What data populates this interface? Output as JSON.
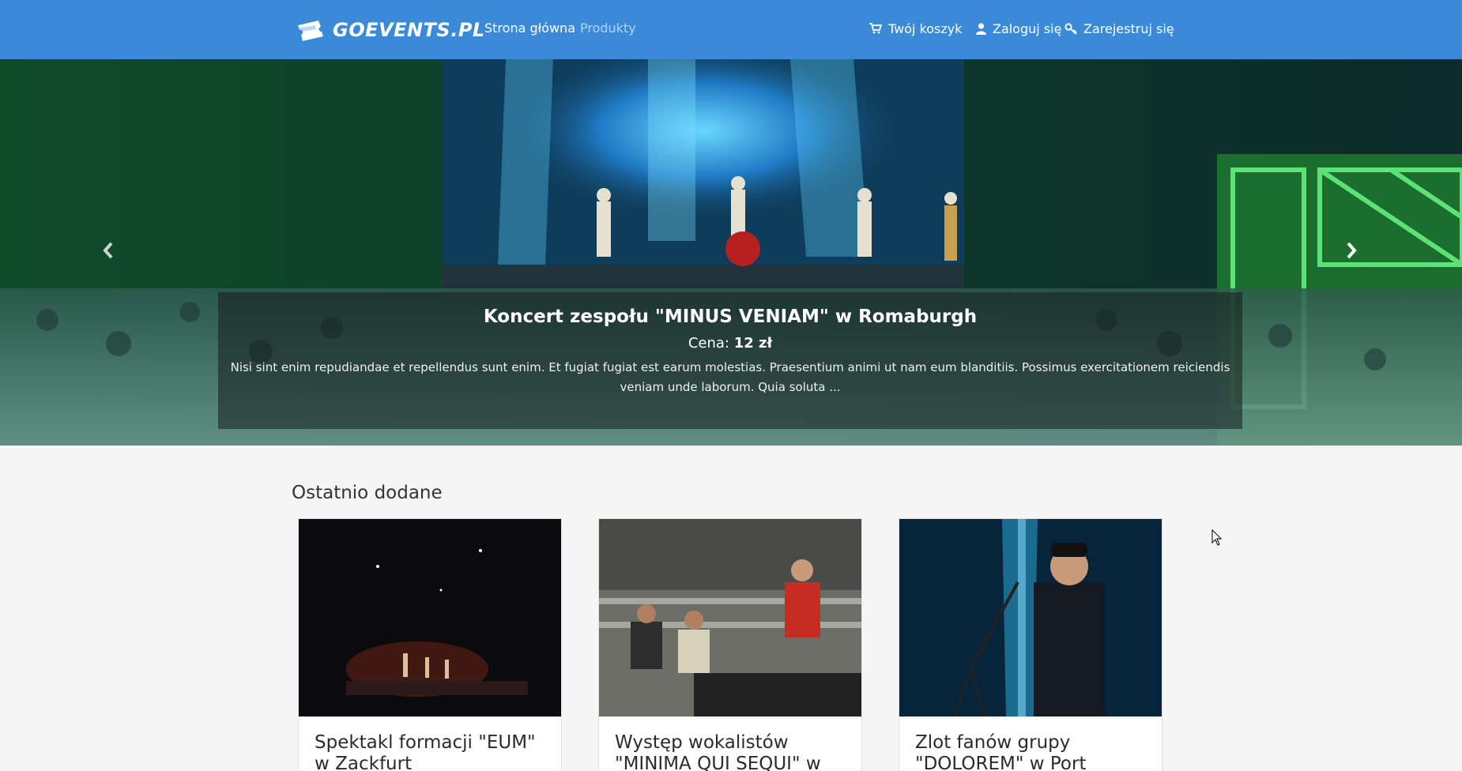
{
  "navbar": {
    "brand": "GOEVENTS.PL",
    "links": [
      {
        "label": "Strona główna",
        "active": true
      },
      {
        "label": "Produkty",
        "active": false
      }
    ],
    "cart_label": "Twój koszyk",
    "login_label": "Zaloguj się",
    "register_label": "Zarejestruj się",
    "bg_color": "#3a8ad9"
  },
  "carousel": {
    "slide": {
      "title": "Koncert zespołu \"MINUS VENIAM\" w Romaburgh",
      "price_label": "Cena:",
      "price_value": "12 zł",
      "description": "Nisi sint enim repudiandae et repellendus sunt enim. Et fugiat fugiat est earum molestias. Praesentium animi ut nam eum blanditiis. Possimus exercitationem reiciendis veniam unde laborum. Quia soluta ..."
    },
    "indicator_count": 10,
    "active_indicator": 10,
    "prev_icon": "chevron-left-icon",
    "next_icon": "chevron-right-icon"
  },
  "recent": {
    "title": "Ostatnio dodane",
    "cards": [
      {
        "title": "Spektakl formacji \"EUM\" w Zackfurt"
      },
      {
        "title": "Występ wokalistów \"MINIMA QUI SEQUI\" w"
      },
      {
        "title": "Zlot fanów grupy \"DOLOREM\" w Port"
      }
    ]
  }
}
